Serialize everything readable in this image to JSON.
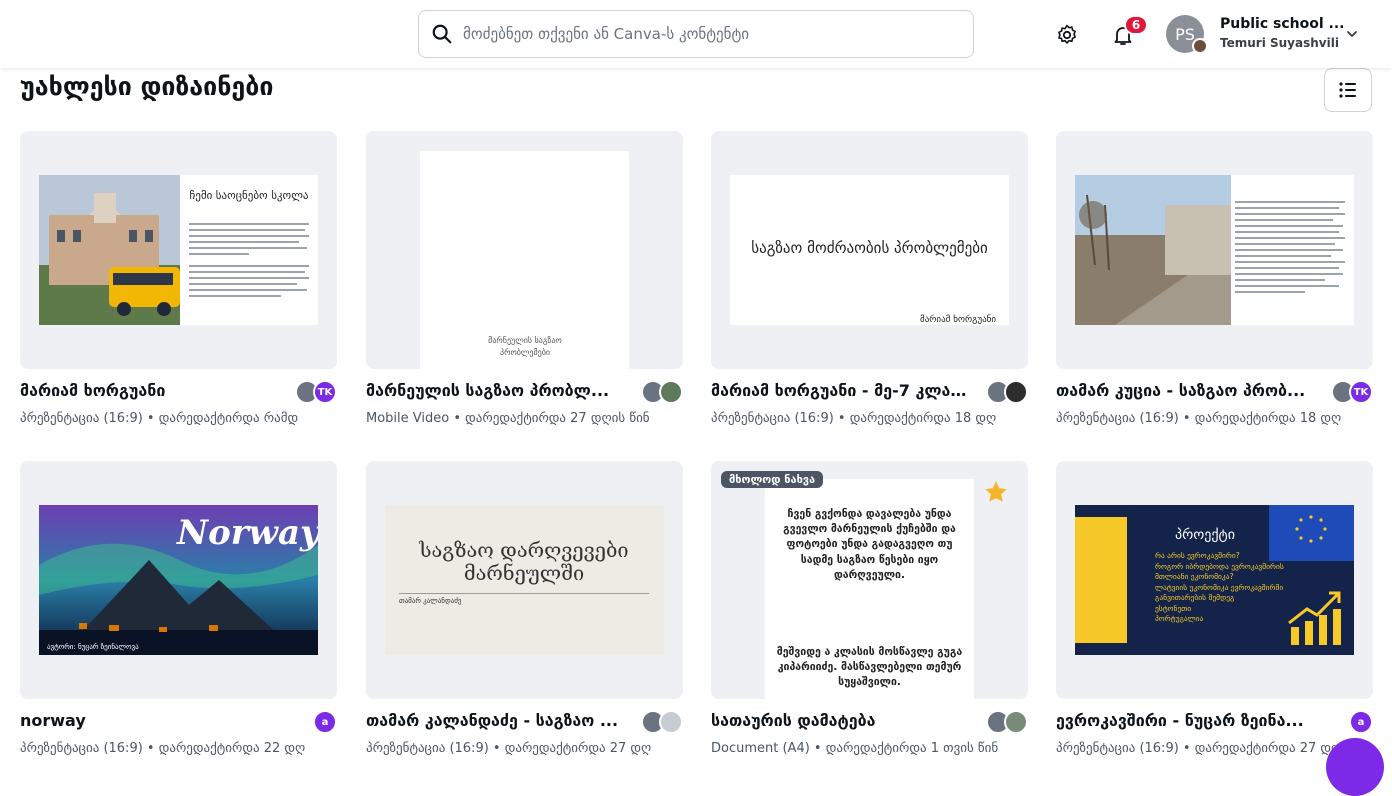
{
  "search": {
    "placeholder": "მოძებნეთ თქვენი ან Canva-ს კონტენტი"
  },
  "header": {
    "notifications_count": "6",
    "avatar_initials": "PS",
    "account_name": "Public school ...",
    "account_user": "Temuri Suyashvili"
  },
  "page": {
    "title": "უახლესი დიზაინები"
  },
  "cards": [
    {
      "title": "მარიამ ხორგუანი",
      "meta": "პრეზენტაცია (16:9) • დარედაქტირდა რამდ",
      "avatars": [
        "",
        "TK"
      ],
      "slide": {
        "heading": "ჩემი საოცნებო სკოლა"
      }
    },
    {
      "title": "მარნეულის საგზაო პრობლ...",
      "meta": "Mobile Video • დარედაქტირდა 27 დღის წინ",
      "avatars": [
        "",
        ""
      ],
      "slide": {
        "caption": "მარნეულის საგზაო პრობლემები"
      }
    },
    {
      "title": "მარიამ ხორგუანი - მე-7 კლა...",
      "meta": "პრეზენტაცია (16:9) • დარედაქტირდა 18 დღ",
      "avatars": [
        "",
        ""
      ],
      "slide": {
        "heading": "საგზაო მოძრაობის პრობლემები",
        "footer": "მარიამ ხორგუანი"
      }
    },
    {
      "title": "თამარ კუცია - საზგაო პრობ...",
      "meta": "პრეზენტაცია (16:9) • დარედაქტირდა 18 დღ",
      "avatars": [
        "",
        "TK"
      ]
    },
    {
      "title": "norway",
      "meta": "პრეზენტაცია (16:9) • დარედაქტირდა 22 დღ",
      "avatars": [
        "a"
      ],
      "slide": {
        "heading": "Norway",
        "footer": "ავტორი: ნუცარ ზეინალოვა"
      }
    },
    {
      "title": "თამარ კალანდაძე - საგზაო ...",
      "meta": "პრეზენტაცია (16:9) • დარედაქტირდა 27 დღ",
      "avatars": [
        "",
        ""
      ],
      "slide": {
        "heading": "საგზაო დარღვევები მარნეულში",
        "footer": "თამარ კალანდაძე"
      }
    },
    {
      "title": "სათაურის დამატება",
      "meta": "Document (A4) • დარედაქტირდა 1 თვის წინ",
      "avatars": [
        "",
        ""
      ],
      "tag": "მხოლოდ ნახვა",
      "slide": {
        "para1": "ჩვენ გვქონდა დავალება უნდა გვევლო მარნეულის ქუჩებში და ფოტოები უნდა გადაგვეღო თუ სადმე საგზაო წესები იყო დარღვეული.",
        "para2": "მეშვიდე ა კლასის მოსწავლე გუგა კიპარიიძე. მასწავლებელი თემურ სუყაშვილი."
      }
    },
    {
      "title": "ევროკავშირი - ნუცარ ზეინა...",
      "meta": "პრეზენტაცია (16:9) • დარედაქტირდა 27 დღ",
      "avatars": [
        "a"
      ],
      "slide": {
        "heading": "პროექტი",
        "bullets": [
          "რა არის ევროკავშირი?",
          "როგორ იბრდებოდა ევროკავშირის მთლიანი ეკონომიკა?",
          "ლატვიის ეკონომიკა ევროკავშირში განვითარების შემდეგ",
          "ესტონეთი",
          "პორტუგალია"
        ]
      }
    }
  ],
  "colors": {
    "accent": "#7d2ae8",
    "badge": "#e2163a",
    "card_bg": "#eef0f3"
  }
}
